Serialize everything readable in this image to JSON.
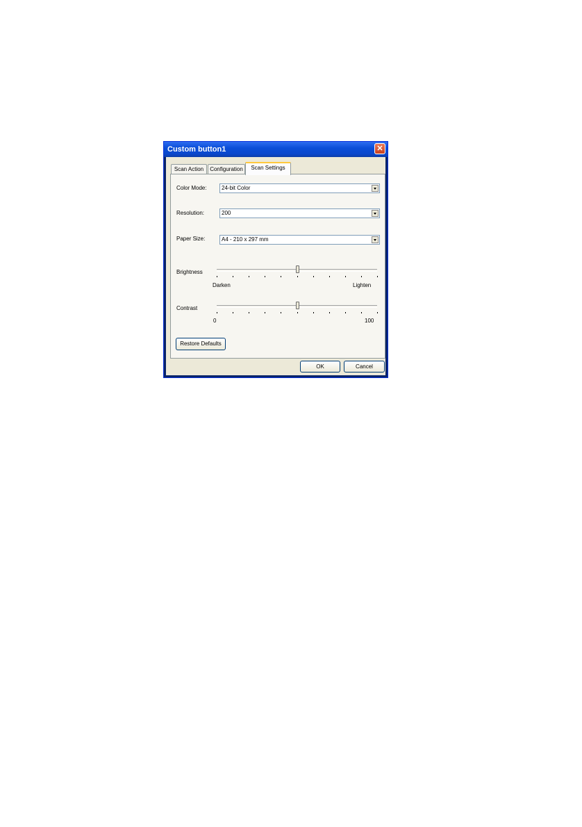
{
  "window": {
    "title": "Custom button1"
  },
  "tabs": [
    "Scan Action",
    "Configuration",
    "Scan Settings"
  ],
  "fields": {
    "color_mode": {
      "label": "Color Mode:",
      "value": "24-bit Color"
    },
    "resolution": {
      "label": "Resolution:",
      "value": "200"
    },
    "paper_size": {
      "label": "Paper Size:",
      "value": "A4 - 210 x 297 mm"
    }
  },
  "brightness": {
    "label": "Brightness",
    "min_label": "Darken",
    "max_label": "Lighten",
    "value": 0.5
  },
  "contrast": {
    "label": "Contrast",
    "min_label": "0",
    "max_label": "100",
    "value": 0.5
  },
  "buttons": {
    "restore": "Restore Defaults",
    "ok": "OK",
    "cancel": "Cancel"
  }
}
